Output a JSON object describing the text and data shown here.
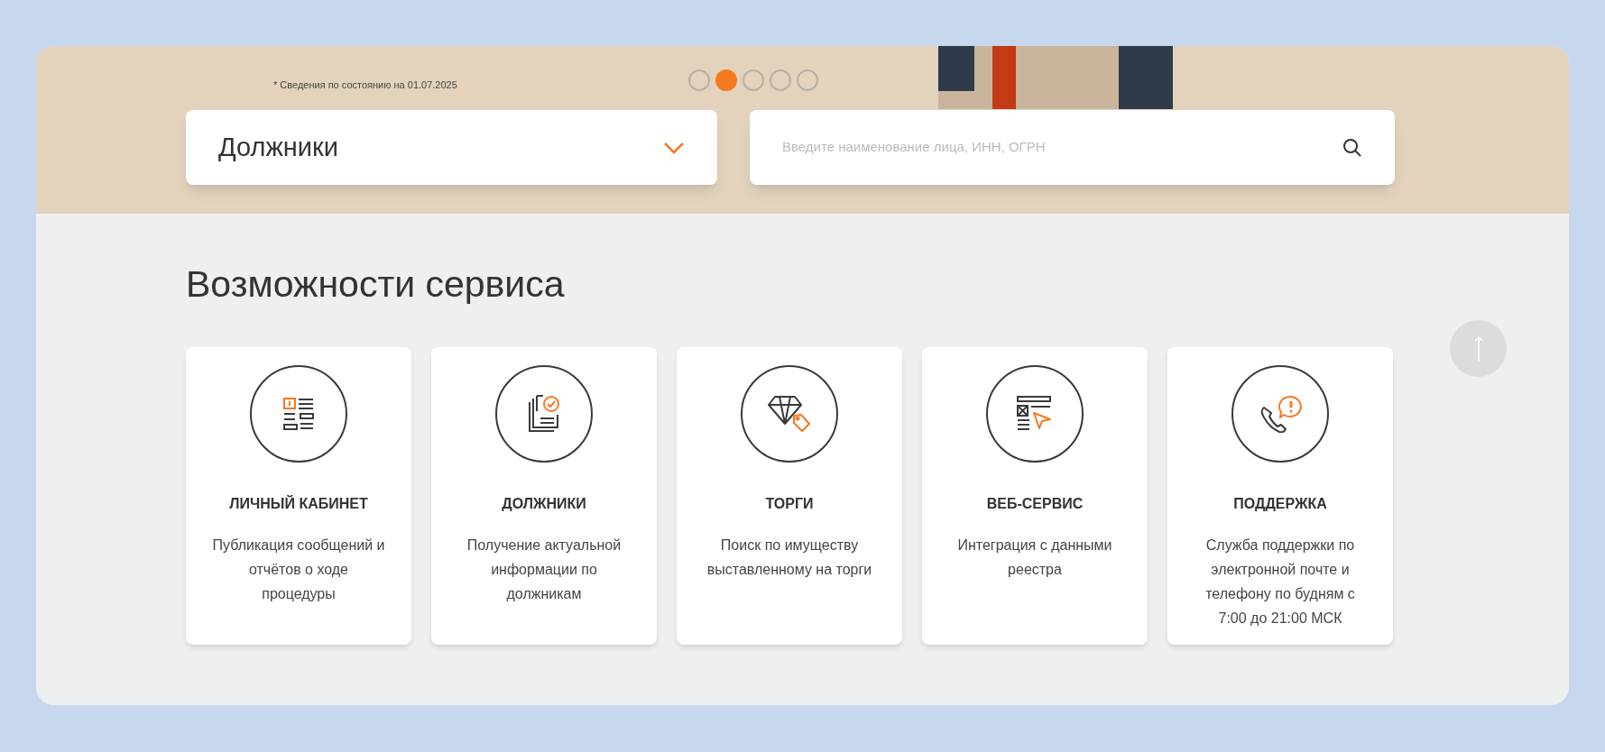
{
  "banner": {
    "note": "* Сведения по состоянию на 01.07.2025",
    "carousel_dots": [
      {
        "selected": false
      },
      {
        "selected": true
      },
      {
        "selected": false
      },
      {
        "selected": false
      },
      {
        "selected": false
      }
    ],
    "category_select": {
      "value": "Должники"
    },
    "search": {
      "placeholder": "Введите наименование лица, ИНН, ОГРН"
    }
  },
  "section": {
    "title": "Возможности сервиса",
    "cards": [
      {
        "kind": "cabinet",
        "title": "ЛИЧНЫЙ КАБИНЕТ",
        "text": "Публикация сообщений и отчётов о ходе процедуры"
      },
      {
        "kind": "debtors",
        "title": "ДОЛЖНИКИ",
        "text": "Получение актуальной информации по должникам"
      },
      {
        "kind": "auctions",
        "title": "ТОРГИ",
        "text": "Поиск по имуществу выставленному на торги"
      },
      {
        "kind": "webservice",
        "title": "ВЕБ-СЕРВИС",
        "text": "Интеграция с данными реестра"
      },
      {
        "kind": "support",
        "title": "ПОДДЕРЖКА",
        "text": "Служба поддержки по электронной почте и телефону по будням с 7:00 до 21:00 МСК"
      }
    ]
  }
}
